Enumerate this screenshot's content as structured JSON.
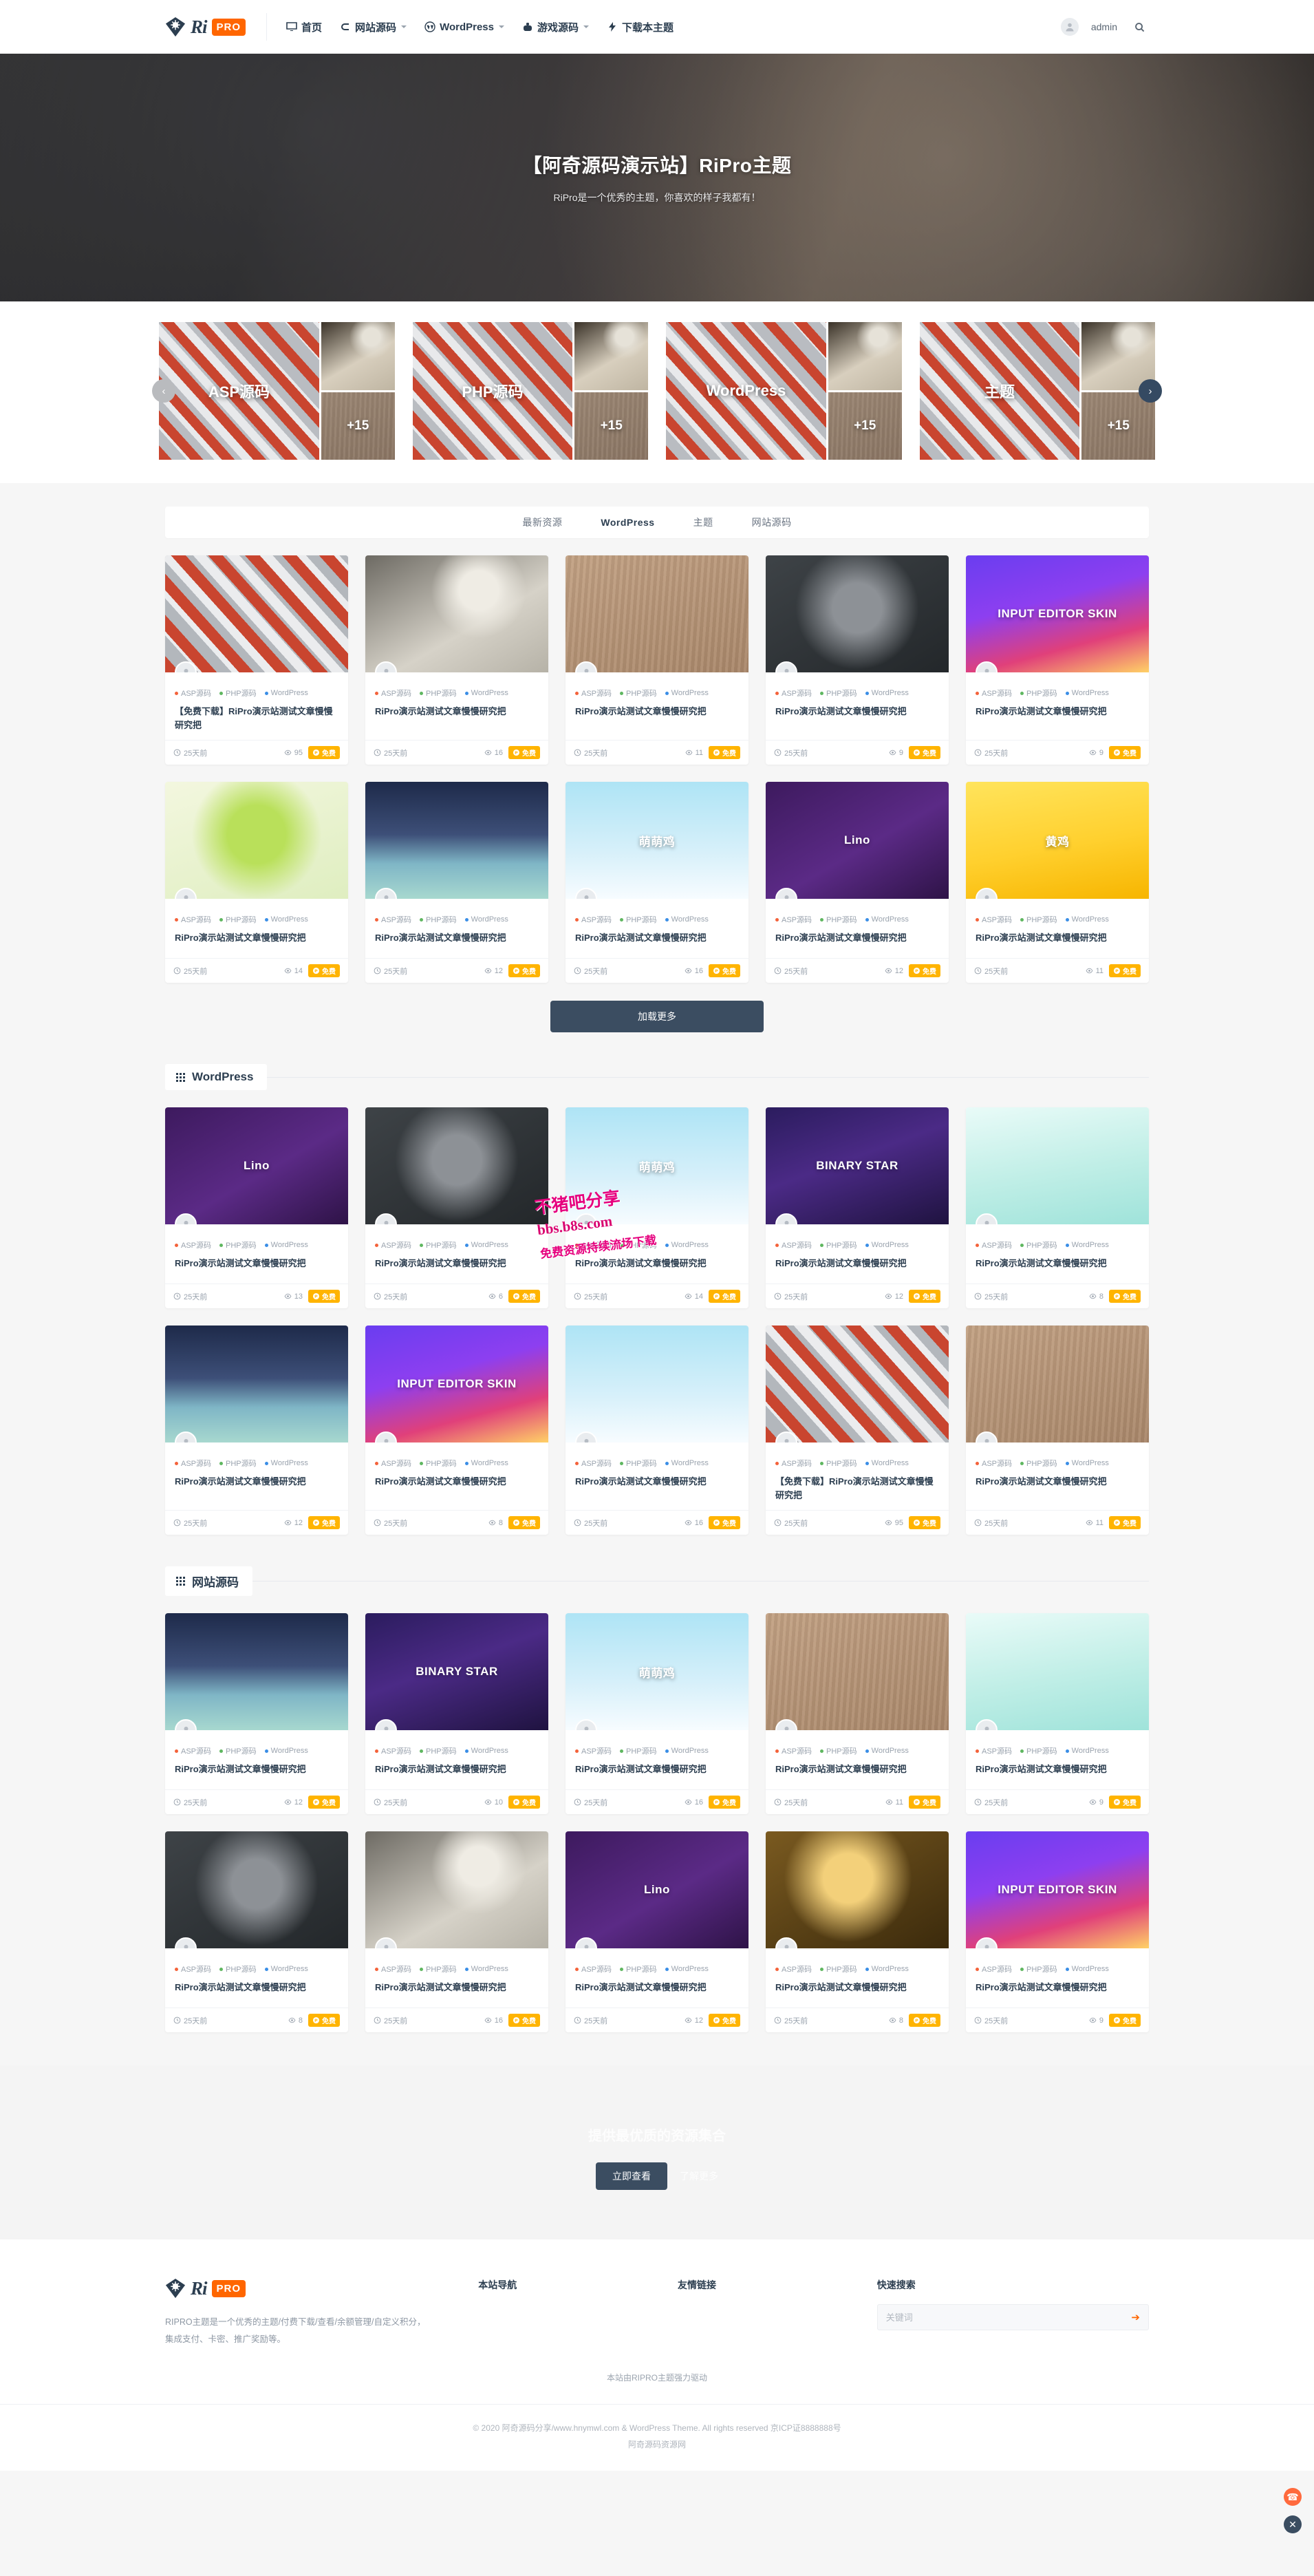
{
  "header": {
    "logo": {
      "ri": "Ri",
      "pro": "PRO",
      "icon": "diamond-logo-icon"
    },
    "nav": [
      {
        "label": "首页",
        "icon": "monitor-icon",
        "caret": false
      },
      {
        "label": "网站源码",
        "icon": "elementor-icon",
        "caret": true
      },
      {
        "label": "WordPress",
        "icon": "wordpress-icon",
        "caret": true
      },
      {
        "label": "游戏源码",
        "icon": "gamepad-icon",
        "caret": true
      },
      {
        "label": "下载本主题",
        "icon": "bolt-icon",
        "caret": false
      }
    ],
    "user": "admin",
    "search_icon": "search-icon"
  },
  "hero": {
    "title": "【阿奇源码演示站】RiPro主题",
    "subtitle": "RiPro是一个优秀的主题，你喜欢的样子我都有！"
  },
  "carousel": {
    "prev_icon": "chevron-left-icon",
    "next_icon": "chevron-right-icon",
    "cards": [
      {
        "label": "ASP源码",
        "plus": "+15"
      },
      {
        "label": "PHP源码",
        "plus": "+15"
      },
      {
        "label": "WordPress",
        "plus": "+15"
      },
      {
        "label": "主题",
        "plus": "+15"
      }
    ]
  },
  "tabs": [
    {
      "label": "最新资源",
      "active": false
    },
    {
      "label": "WordPress",
      "active": true
    },
    {
      "label": "主题",
      "active": false
    },
    {
      "label": "网站源码",
      "active": false
    }
  ],
  "card_defaults": {
    "cats": [
      {
        "label": "ASP源码",
        "color": "#f4623a"
      },
      {
        "label": "PHP源码",
        "color": "#5fb760"
      },
      {
        "label": "WordPress",
        "color": "#3a8ee6"
      }
    ],
    "time_icon": "clock-icon",
    "views_icon": "eye-icon",
    "badge_icon": "coin-icon",
    "badge_label": "免费",
    "avatar_icon": "user-avatar-icon"
  },
  "sections": {
    "latest": {
      "cards": [
        {
          "title": "【免费下载】RiPro演示站测试文章慢慢研究把",
          "time": "25天前",
          "views": "95",
          "badge": "免费",
          "thumb": "th-cans",
          "thumb_text": ""
        },
        {
          "title": "RiPro演示站测试文章慢慢研究把",
          "time": "25天前",
          "views": "16",
          "badge": "免费",
          "thumb": "th-logo",
          "thumb_text": ""
        },
        {
          "title": "RiPro演示站测试文章慢慢研究把",
          "time": "25天前",
          "views": "11",
          "badge": "免费",
          "thumb": "th-wood",
          "thumb_text": ""
        },
        {
          "title": "RiPro演示站测试文章慢慢研究把",
          "time": "25天前",
          "views": "9",
          "badge": "免费",
          "thumb": "th-dark",
          "thumb_text": ""
        },
        {
          "title": "RiPro演示站测试文章慢慢研究把",
          "time": "25天前",
          "views": "9",
          "badge": "免费",
          "thumb": "th-neon",
          "thumb_text": "INPUT EDITOR SKIN"
        },
        {
          "title": "RiPro演示站测试文章慢慢研究把",
          "time": "25天前",
          "views": "14",
          "badge": "免费",
          "thumb": "th-green",
          "thumb_text": ""
        },
        {
          "title": "RiPro演示站测试文章慢慢研究把",
          "time": "25天前",
          "views": "12",
          "badge": "免费",
          "thumb": "th-night",
          "thumb_text": ""
        },
        {
          "title": "RiPro演示站测试文章慢慢研究把",
          "time": "25天前",
          "views": "16",
          "badge": "免费",
          "thumb": "th-chick",
          "thumb_text": "萌萌鸡"
        },
        {
          "title": "RiPro演示站测试文章慢慢研究把",
          "time": "25天前",
          "views": "12",
          "badge": "免费",
          "thumb": "th-purple",
          "thumb_text": "Lino"
        },
        {
          "title": "RiPro演示站测试文章慢慢研究把",
          "time": "25天前",
          "views": "11",
          "badge": "免费",
          "thumb": "th-yellow",
          "thumb_text": "黄鸡"
        }
      ],
      "loadmore": "加载更多"
    },
    "wordpress": {
      "title": "WordPress",
      "icon": "grid-icon",
      "cards": [
        {
          "title": "RiPro演示站测试文章慢慢研究把",
          "time": "25天前",
          "views": "13",
          "badge": "免费",
          "thumb": "th-purple",
          "thumb_text": "Lino"
        },
        {
          "title": "RiPro演示站测试文章慢慢研究把",
          "time": "25天前",
          "views": "6",
          "badge": "免费",
          "thumb": "th-dark",
          "thumb_text": ""
        },
        {
          "title": "RiPro演示站测试文章慢慢研究把",
          "time": "25天前",
          "views": "14",
          "badge": "免费",
          "thumb": "th-chick",
          "thumb_text": "萌萌鸡"
        },
        {
          "title": "RiPro演示站测试文章慢慢研究把",
          "time": "25天前",
          "views": "12",
          "badge": "免费",
          "thumb": "th-star",
          "thumb_text": "BINARY STAR"
        },
        {
          "title": "RiPro演示站测试文章慢慢研究把",
          "time": "25天前",
          "views": "8",
          "badge": "免费",
          "thumb": "th-mint",
          "thumb_text": ""
        },
        {
          "title": "RiPro演示站测试文章慢慢研究把",
          "time": "25天前",
          "views": "12",
          "badge": "免费",
          "thumb": "th-night",
          "thumb_text": ""
        },
        {
          "title": "RiPro演示站测试文章慢慢研究把",
          "time": "25天前",
          "views": "8",
          "badge": "免费",
          "thumb": "th-neon",
          "thumb_text": "INPUT EDITOR SKIN"
        },
        {
          "title": "RiPro演示站测试文章慢慢研究把",
          "time": "25天前",
          "views": "16",
          "badge": "免费",
          "thumb": "th-chick",
          "thumb_text": ""
        },
        {
          "title": "【免费下载】RiPro演示站测试文章慢慢研究把",
          "time": "25天前",
          "views": "95",
          "badge": "免费",
          "thumb": "th-cans",
          "thumb_text": ""
        },
        {
          "title": "RiPro演示站测试文章慢慢研究把",
          "time": "25天前",
          "views": "11",
          "badge": "免费",
          "thumb": "th-wood",
          "thumb_text": ""
        }
      ]
    },
    "website": {
      "title": "网站源码",
      "icon": "grid-icon",
      "cards": [
        {
          "title": "RiPro演示站测试文章慢慢研究把",
          "time": "25天前",
          "views": "12",
          "badge": "免费",
          "thumb": "th-night",
          "thumb_text": ""
        },
        {
          "title": "RiPro演示站测试文章慢慢研究把",
          "time": "25天前",
          "views": "10",
          "badge": "免费",
          "thumb": "th-star",
          "thumb_text": "BINARY STAR"
        },
        {
          "title": "RiPro演示站测试文章慢慢研究把",
          "time": "25天前",
          "views": "16",
          "badge": "免费",
          "thumb": "th-chick",
          "thumb_text": "萌萌鸡"
        },
        {
          "title": "RiPro演示站测试文章慢慢研究把",
          "time": "25天前",
          "views": "11",
          "badge": "免费",
          "thumb": "th-wood",
          "thumb_text": ""
        },
        {
          "title": "RiPro演示站测试文章慢慢研究把",
          "time": "25天前",
          "views": "9",
          "badge": "免费",
          "thumb": "th-mint",
          "thumb_text": ""
        },
        {
          "title": "RiPro演示站测试文章慢慢研究把",
          "time": "25天前",
          "views": "8",
          "badge": "免费",
          "thumb": "th-dark",
          "thumb_text": ""
        },
        {
          "title": "RiPro演示站测试文章慢慢研究把",
          "time": "25天前",
          "views": "16",
          "badge": "免费",
          "thumb": "th-logo",
          "thumb_text": ""
        },
        {
          "title": "RiPro演示站测试文章慢慢研究把",
          "time": "25天前",
          "views": "12",
          "badge": "免费",
          "thumb": "th-purple",
          "thumb_text": "Lino"
        },
        {
          "title": "RiPro演示站测试文章慢慢研究把",
          "time": "25天前",
          "views": "8",
          "badge": "免费",
          "thumb": "th-gold",
          "thumb_text": ""
        },
        {
          "title": "RiPro演示站测试文章慢慢研究把",
          "time": "25天前",
          "views": "9",
          "badge": "免费",
          "thumb": "th-neon",
          "thumb_text": "INPUT EDITOR SKIN"
        }
      ]
    }
  },
  "cta": {
    "title": "提供最优质的资源集合",
    "primary": "立即查看",
    "secondary": "了解更多"
  },
  "footer": {
    "logo": {
      "ri": "Ri",
      "pro": "PRO"
    },
    "desc_line1": "RIPRO主题是一个优秀的主题/付费下载/查看/余额管理/自定义积分，",
    "desc_line2": "集成支付、卡密、推广奖励等。",
    "columns": [
      {
        "title": "本站导航"
      },
      {
        "title": "友情链接"
      }
    ],
    "search": {
      "title": "快速搜索",
      "placeholder": "关键词",
      "go_icon": "arrow-right-icon"
    },
    "powered": "本站由RIPRO主题强力驱动",
    "copyright": "© 2020 阿奇源码分享/www.hnymwl.com & WordPress Theme. All rights reserved 京ICP证8888888号",
    "site_name": "阿奇源码资源网"
  },
  "floating": [
    {
      "name": "customer-service-icon",
      "glyph": "☎",
      "color": "#ff6a3d"
    },
    {
      "name": "close-icon",
      "glyph": "✕",
      "color": "#3b4d61"
    }
  ],
  "watermark": {
    "line1": "不猪吧分享",
    "line2": "bbs.b8s.com",
    "line3": "免费资源持续流场下载"
  },
  "colors": {
    "accent": "#f60",
    "dark": "#3b4d61",
    "badge": "#ffb400",
    "text": "#2c3e50"
  }
}
